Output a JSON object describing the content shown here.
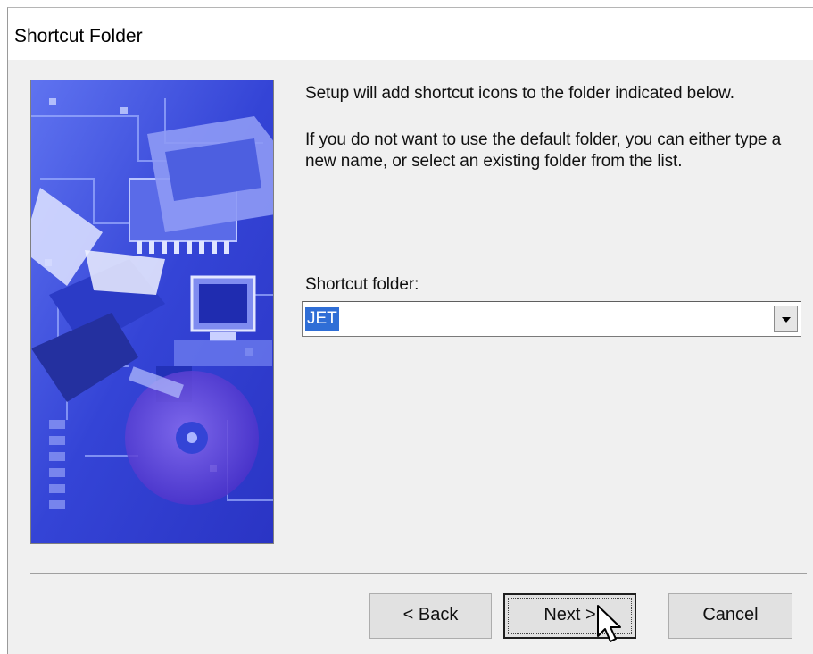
{
  "window": {
    "title": "Shortcut Folder"
  },
  "content": {
    "intro": "Setup will add shortcut icons to the folder indicated below.",
    "instruction": "If you do not want to use the default folder, you can either type a new name, or select an existing folder from the list.",
    "field_label": "Shortcut folder:",
    "field_value": "JET"
  },
  "buttons": {
    "back": "< Back",
    "next": "Next >",
    "cancel": "Cancel"
  },
  "colors": {
    "dialog_bg": "#f0f0f0",
    "selection": "#2f6ed6",
    "side_image": "#3546d8"
  },
  "icons": {
    "dropdown": "chevron-down-icon",
    "cursor": "mouse-pointer-icon"
  }
}
